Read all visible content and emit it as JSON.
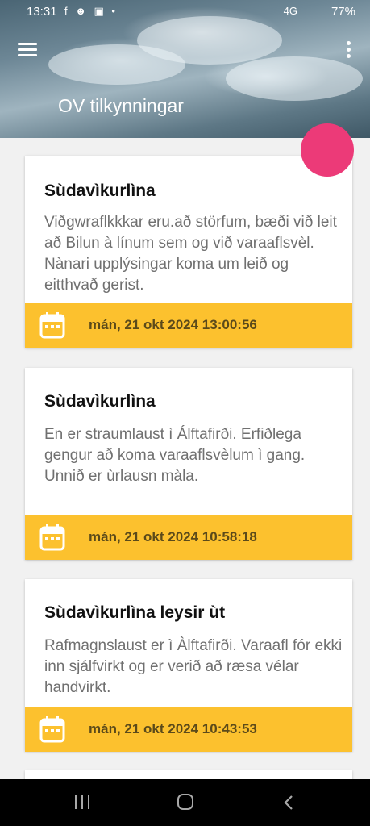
{
  "status_bar": {
    "time": "13:31",
    "notifications": "f ☻ ▣ •",
    "network": "4G",
    "battery": "77%"
  },
  "app": {
    "title": "OV tilkynningar"
  },
  "notifications": [
    {
      "title": "Sùdavìkurlìna",
      "body": "Viðgwraflkkkar eru.að störfum, bæði við leit að Bilun à línum sem og við varaaflsvèl. Nànari upplýsingar koma um leið og eitthvað gerist.",
      "date": "mán, 21 okt 2024 13:00:56"
    },
    {
      "title": "Sùdavìkurlìna",
      "body": "En er straumlaust ì Álftafirði. Erfiðlega gengur að koma varaaflsvèlum ì gang. Unnið er ùrlausn màla.",
      "date": "mán, 21 okt 2024 10:58:18"
    },
    {
      "title": "Sùdavìkurlìna leysir ùt",
      "body": "Rafmagnslaust er ì Àlftafirði. Varaafl fór ekki inn sjálfvirkt og er verið að ræsa vélar handvirkt.",
      "date": "mán, 21 okt 2024 10:43:53"
    }
  ],
  "colors": {
    "accent_fab": "#ec3a78",
    "date_bar": "#fcc12e",
    "calendar_icon": "#ffffff"
  },
  "icons": {
    "menu": "hamburger-menu-icon",
    "more": "more-vert-icon",
    "calendar": "calendar-icon",
    "nav_recents": "recents-icon",
    "nav_home": "home-icon",
    "nav_back": "back-icon"
  }
}
